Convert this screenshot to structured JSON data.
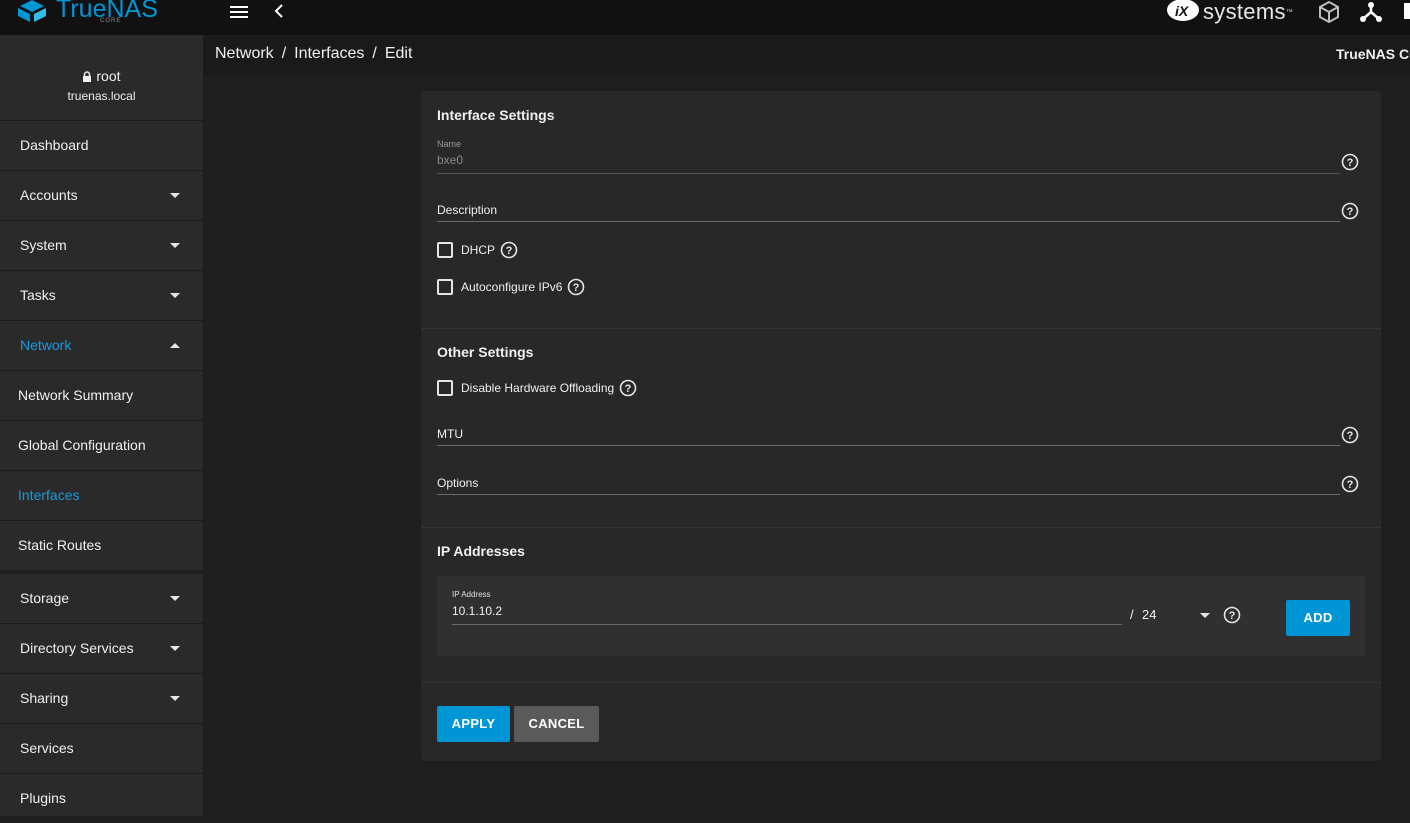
{
  "topbar": {
    "logo_name": "TrueNAS",
    "logo_sub": "CORE",
    "vendor_text": "systems",
    "vendor_tm": "™"
  },
  "user": {
    "name": "root",
    "host": "truenas.local"
  },
  "sidebar": {
    "items": [
      {
        "label": "Dashboard"
      },
      {
        "label": "Accounts"
      },
      {
        "label": "System"
      },
      {
        "label": "Tasks"
      },
      {
        "label": "Network"
      },
      {
        "label": "Network Summary"
      },
      {
        "label": "Global Configuration"
      },
      {
        "label": "Interfaces"
      },
      {
        "label": "Static Routes"
      },
      {
        "label": "Storage"
      },
      {
        "label": "Directory Services"
      },
      {
        "label": "Sharing"
      },
      {
        "label": "Services"
      },
      {
        "label": "Plugins"
      }
    ]
  },
  "breadcrumb": {
    "items": [
      "Network",
      "Interfaces",
      "Edit"
    ],
    "separator": "/",
    "product": "TrueNAS CORE"
  },
  "form": {
    "interface_settings": {
      "title": "Interface Settings",
      "name_label": "Name",
      "name_value": "bxe0",
      "description_label": "Description",
      "dhcp_label": "DHCP",
      "autoconf_label": "Autoconfigure IPv6"
    },
    "other_settings": {
      "title": "Other Settings",
      "disable_offload_label": "Disable Hardware Offloading",
      "mtu_label": "MTU",
      "options_label": "Options"
    },
    "ip_addresses": {
      "title": "IP Addresses",
      "ip_label": "IP Address",
      "ip_value": "10.1.10.2",
      "slash": "/",
      "netmask": "24",
      "add_label": "ADD"
    },
    "apply_label": "APPLY",
    "cancel_label": "CANCEL"
  },
  "colors": {
    "accent": "#0095d5",
    "active_nav": "#1a9ae0",
    "card_bg": "#282828",
    "sidebar_bg": "#2a2a2a"
  }
}
